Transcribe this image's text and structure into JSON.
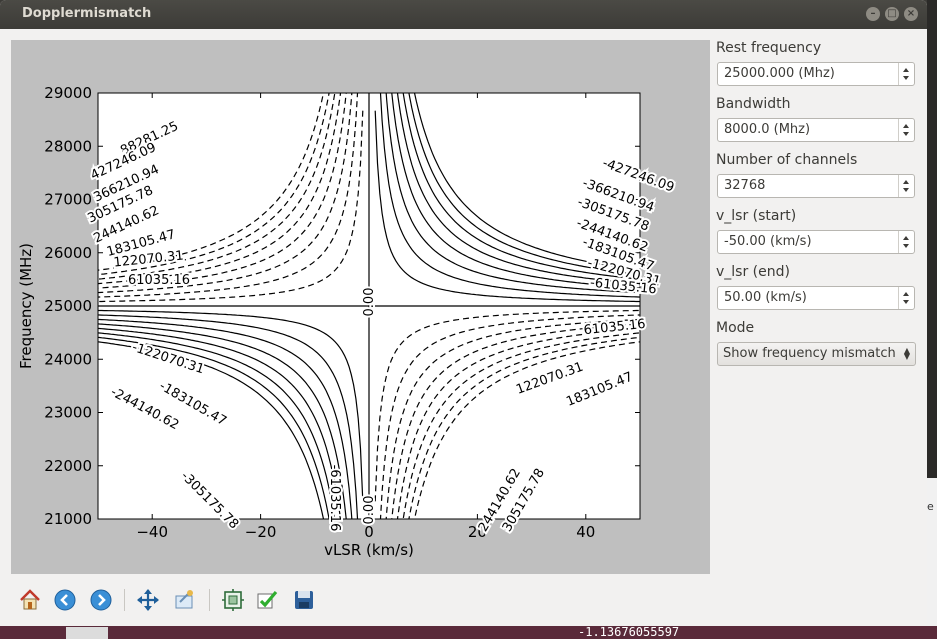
{
  "window": {
    "title": "Dopplermismatch"
  },
  "background": {
    "terminal_value": "-1.13676055597",
    "side_glyph": "e"
  },
  "panel": {
    "rest_frequency": {
      "label": "Rest frequency",
      "value": "25000.000 (Mhz)"
    },
    "bandwidth": {
      "label": "Bandwidth",
      "value": "8000.0 (Mhz)"
    },
    "num_channels": {
      "label": "Number of channels",
      "value": "32768"
    },
    "vlsr_start": {
      "label": "v_lsr (start)",
      "value": "-50.00 (km/s)"
    },
    "vlsr_end": {
      "label": "v_lsr (end)",
      "value": "50.00 (km/s)"
    },
    "mode": {
      "label": "Mode",
      "value": "Show frequency mismatch"
    }
  },
  "toolbar": {
    "icons": [
      "home-icon",
      "back-arrow-icon",
      "forward-arrow-icon",
      "pan-icon",
      "zoom-icon",
      "configure-subplots-icon",
      "check-icon",
      "save-icon"
    ]
  },
  "chart_data": {
    "type": "contour",
    "title": "",
    "xlabel": "vLSR (km/s)",
    "ylabel": "Frequency (MHz)",
    "xlim": [
      -50,
      50
    ],
    "ylim": [
      21000,
      29000
    ],
    "xticks": [
      "−40",
      "−20",
      "0",
      "20",
      "40"
    ],
    "xtick_values": [
      -40,
      -20,
      0,
      20,
      40
    ],
    "yticks": [
      "21000",
      "22000",
      "23000",
      "24000",
      "25000",
      "26000",
      "27000",
      "28000",
      "29000"
    ],
    "ytick_values": [
      21000,
      22000,
      23000,
      24000,
      25000,
      26000,
      27000,
      28000,
      29000
    ],
    "contour_levels": [
      -488281.25,
      -427246.09,
      -366210.94,
      -305175.78,
      -244140.62,
      -183105.47,
      -122070.31,
      -61035.16,
      0,
      61035.16,
      122070.31,
      183105.47,
      244140.62,
      305175.78,
      366210.94,
      427246.09,
      488281.25
    ],
    "contour_line_style": {
      "positive": "solid",
      "negative": "dashed"
    },
    "labels": [
      {
        "text": "88281.25"
      },
      {
        "text": "427246.09"
      },
      {
        "text": "366210.94"
      },
      {
        "text": "305175.78"
      },
      {
        "text": "244140.62"
      },
      {
        "text": "183105.47"
      },
      {
        "text": "122070.31"
      },
      {
        "text": "61035.16"
      },
      {
        "text": "-427246.09"
      },
      {
        "text": "-366210.94"
      },
      {
        "text": "-305175.78"
      },
      {
        "text": "-244140.62"
      },
      {
        "text": "-183105.47"
      },
      {
        "text": "-122070.31"
      },
      {
        "text": "-61035.16"
      },
      {
        "text": "0.00"
      },
      {
        "text": "0.00"
      },
      {
        "text": "61035.16"
      },
      {
        "text": "122070.31"
      },
      {
        "text": "183105.47"
      },
      {
        "text": "-122070.31"
      },
      {
        "text": "-183105.47"
      },
      {
        "text": "-244140.62"
      },
      {
        "text": "-305175.78"
      },
      {
        "text": "-61035.16"
      },
      {
        "text": "244140.62"
      },
      {
        "text": "305175.78"
      }
    ]
  }
}
